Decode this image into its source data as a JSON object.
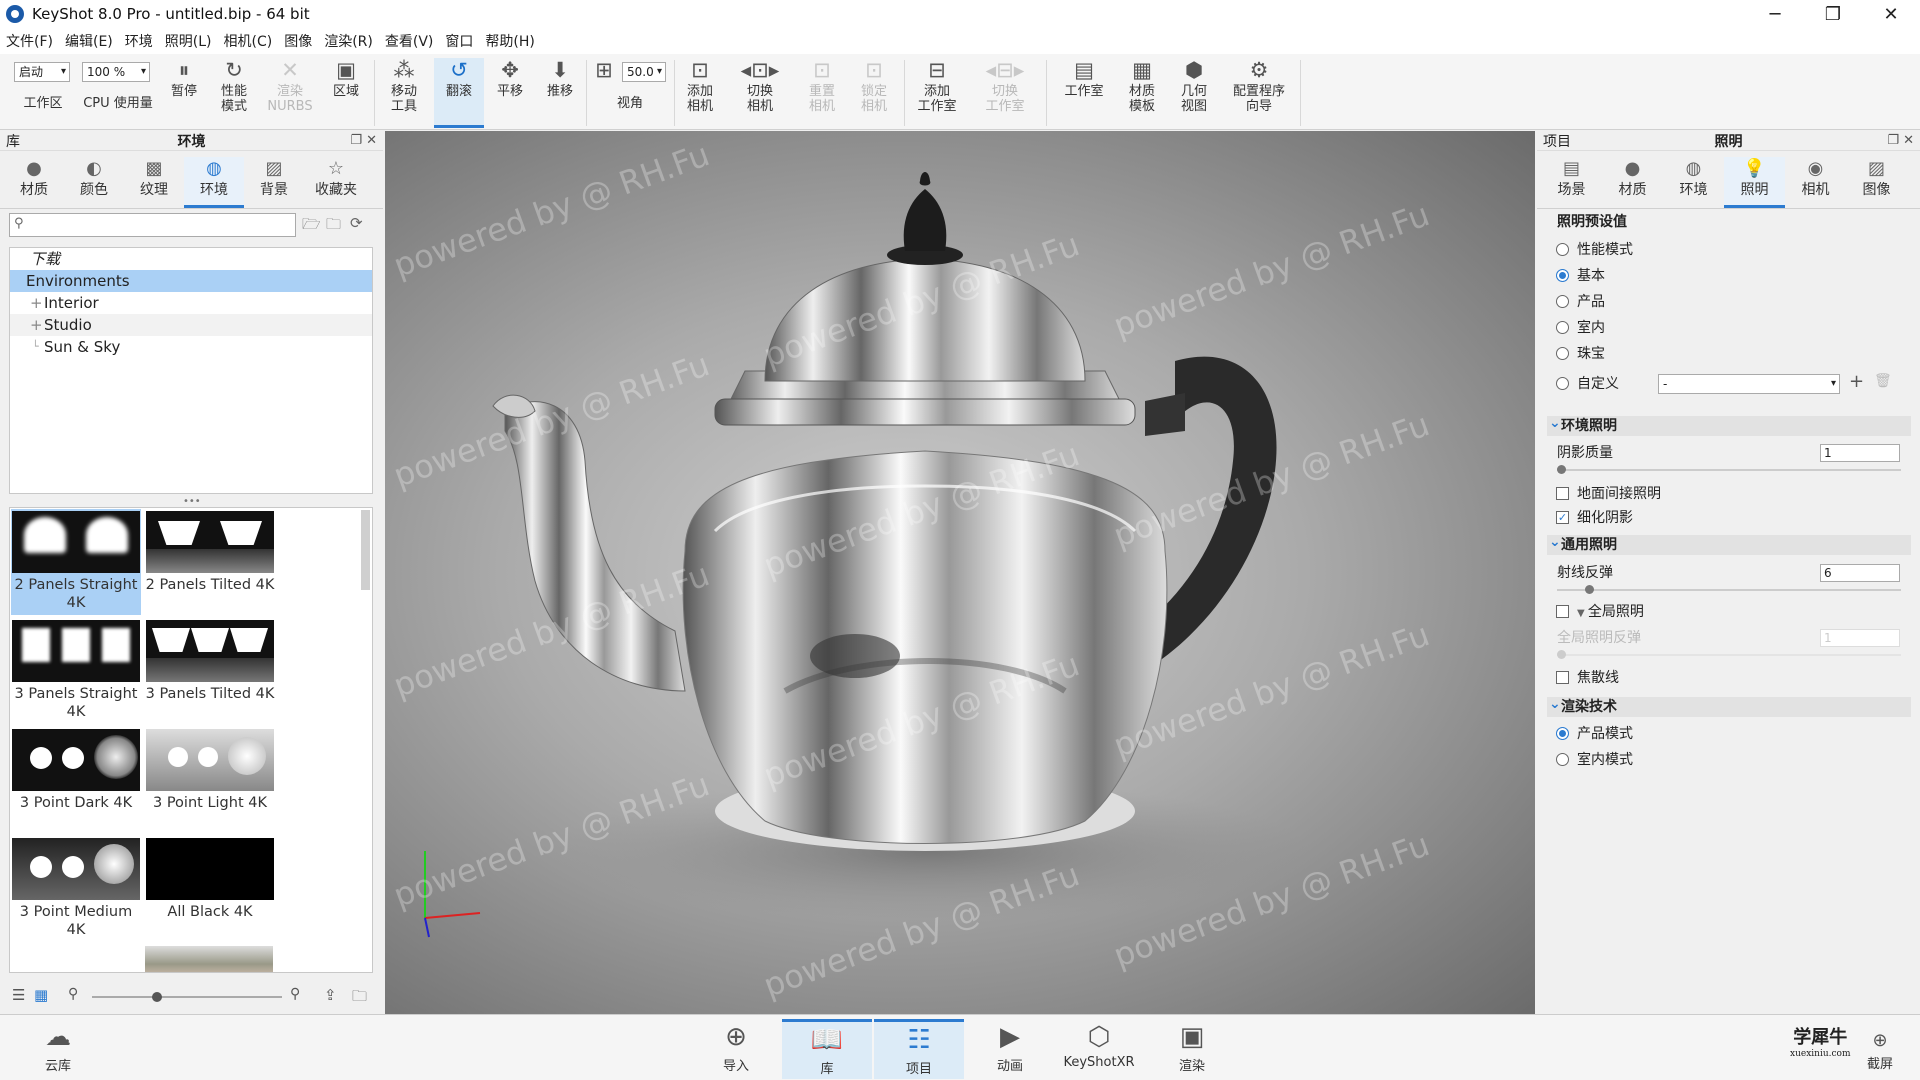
{
  "window": {
    "title": "KeyShot 8.0 Pro  - untitled.bip  - 64 bit",
    "controls": [
      "─",
      "❐",
      "✕"
    ]
  },
  "menu": [
    "文件(F)",
    "编辑(E)",
    "环境",
    "照明(L)",
    "相机(C)",
    "图像",
    "渲染(R)",
    "查看(V)",
    "窗口",
    "帮助(H)"
  ],
  "toolbar": {
    "startup_value": "启动",
    "cpu_value": "100 %",
    "fov_value": "50.0",
    "items": {
      "workspace": "工作区",
      "cpu": "CPU  使用量",
      "pause": "暂停",
      "perf": "性能\n模式",
      "nurbs": "渲染\nNURBS",
      "region": "区域",
      "move_tool": "移动\n工具",
      "tumble": "翻滚",
      "pan": "平移",
      "dolly": "推移",
      "fov": "视角",
      "add_cam": "添加\n相机",
      "switch_cam": "切换\n相机",
      "reset_cam": "重置\n相机",
      "lock_cam": "锁定\n相机",
      "add_studio": "添加\n工作室",
      "switch_studio": "切换\n工作室",
      "studio": "工作室",
      "mat_template": "材质\n模板",
      "geo_view": "几何\n视图",
      "config": "配置程序\n向导"
    }
  },
  "left_panel": {
    "title_left": "库",
    "title_center": "环境",
    "tabs": [
      "材质",
      "颜色",
      "纹理",
      "环境",
      "背景",
      "收藏夹"
    ],
    "selected_tab": 3,
    "search_placeholder": "",
    "tree": [
      {
        "label": "下载",
        "italic": true,
        "indent": 0
      },
      {
        "label": "Environments",
        "indent": 0,
        "selected": true
      },
      {
        "label": "Interior",
        "indent": 1,
        "plus": true
      },
      {
        "label": "Studio",
        "indent": 1,
        "plus": true
      },
      {
        "label": "Sun & Sky",
        "indent": 1
      }
    ],
    "thumbs": [
      {
        "label": "2 Panels Straight 4K",
        "selected": true
      },
      {
        "label": "2 Panels Tilted 4K"
      },
      {
        "label": "3 Panels Straight 4K"
      },
      {
        "label": "3 Panels Tilted 4K"
      },
      {
        "label": "3 Point Dark 4K"
      },
      {
        "label": "3 Point Light 4K"
      },
      {
        "label": "3 Point Medium 4K"
      },
      {
        "label": "All Black 4K"
      }
    ]
  },
  "viewport": {
    "watermark": "powered by @ RH.Fu"
  },
  "right_panel": {
    "title_left": "项目",
    "title_center": "照明",
    "tabs": [
      "场景",
      "材质",
      "环境",
      "照明",
      "相机",
      "图像"
    ],
    "selected_tab": 3,
    "presets_heading": "照明预设值",
    "presets": [
      "性能模式",
      "基本",
      "产品",
      "室内",
      "珠宝",
      "自定义"
    ],
    "preset_selected": 1,
    "custom_value": "-",
    "env_section": "环境照明",
    "shadow_quality_label": "阴影质量",
    "shadow_quality_value": "1",
    "ground_indirect": "地面间接照明",
    "refine_shadows": "细化阴影",
    "general_section": "通用照明",
    "ray_bounces_label": "射线反弹",
    "ray_bounces_value": "6",
    "global_illum": "全局照明",
    "gi_bounces_label": "全局照明反弹",
    "gi_bounces_value": "1",
    "caustics": "焦散线",
    "tech_section": "渲染技术",
    "tech_options": [
      "产品模式",
      "室内模式"
    ],
    "tech_selected": 0
  },
  "bottom_bar": {
    "cloud": "云库",
    "items": [
      "导入",
      "库",
      "项目",
      "动画",
      "KeyShotXR",
      "渲染"
    ],
    "selected": [
      1,
      2
    ],
    "screenshot": "截屏",
    "brand": "学犀牛",
    "brand_url": "xuexiniu.com"
  }
}
